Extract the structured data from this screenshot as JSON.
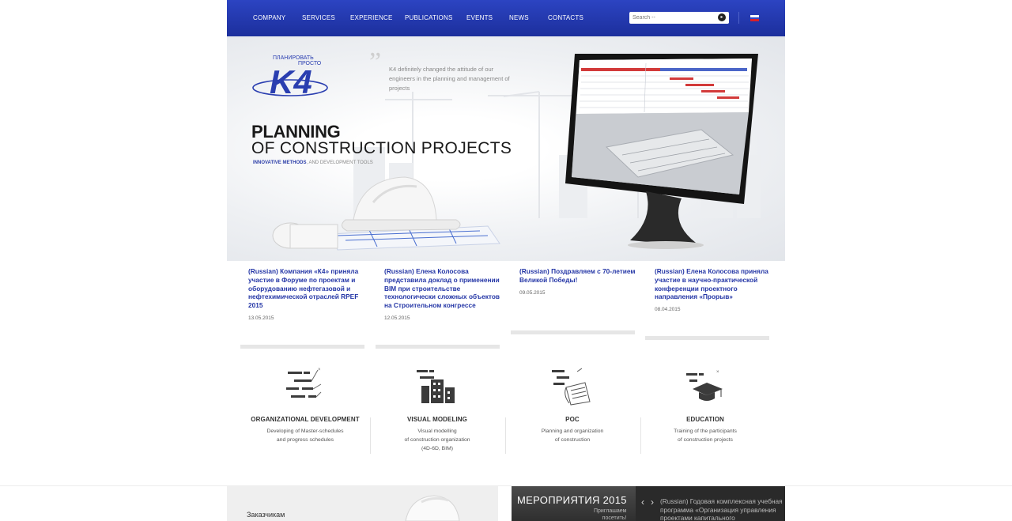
{
  "nav": {
    "items": [
      "COMPANY",
      "SERVICES",
      "EXPERIENCE",
      "PUBLICATIONS",
      "EVENTS",
      "NEWS",
      "CONTACTS"
    ],
    "search_placeholder": "Search --",
    "search_icon": "arrow-right-circle-icon",
    "language": "ru-flag-icon"
  },
  "hero": {
    "logo_text": "ПЛАНИРОВАТЬ ПРОСТО",
    "logo_mark": "K4",
    "quote": "K4 definitely changed the attitude of our engineers in the planning and management of projects",
    "title_line1": "PLANNING",
    "title_line2": "OF CONSTRUCTION PROJECTS",
    "subtitle_highlight": "INNOVATIVE METHODS",
    "subtitle_rest": ", AND DEVELOPMENT TOOLS"
  },
  "news": [
    {
      "title": "(Russian) Компания «К4» приняла участие в Форуме по проектам и оборудованию нефтегазовой и нефтехимической отраслей RPEF 2015",
      "date": "13.05.2015"
    },
    {
      "title": "(Russian) Елена Колосова представила доклад о применении BIM при строительстве технологически сложных объектов на Строительном конгрессе",
      "date": "12.05.2015"
    },
    {
      "title": "(Russian) Поздравляем с 70-летием Великой Победы!",
      "date": "09.05.2015"
    },
    {
      "title": "(Russian) Елена Колосова приняла участие в научно-практической конференции проектного направления «Прорыв»",
      "date": "08.04.2015"
    }
  ],
  "services": [
    {
      "title": "ORGANIZATIONAL DEVELOPMENT",
      "desc": [
        "Developing of Master-schedules",
        "and progress schedules"
      ],
      "icon": "org-chart-icon"
    },
    {
      "title": "VISUAL MODELING",
      "desc": [
        "Visual modelling",
        "of construction organization",
        "(4D-6D, BIM)"
      ],
      "icon": "building-icon"
    },
    {
      "title": "POC",
      "desc": [
        "Planning and organization",
        "of construction"
      ],
      "icon": "document-icon"
    },
    {
      "title": "EDUCATION",
      "desc": [
        "Training of the participants",
        "of construction projects"
      ],
      "icon": "graduation-cap-icon"
    }
  ],
  "bottom": {
    "clients_label": "Заказчикам",
    "events_title": "МЕРОПРИЯТИЯ 2015",
    "events_sub_line1": "Приглашаем",
    "events_sub_line2": "посетить!",
    "events_text": "(Russian) Годовая комплексная учебная программа «Организация управления проектами капитального",
    "prev_icon": "chevron-left-icon",
    "next_icon": "chevron-right-icon"
  },
  "colors": {
    "nav_blue": "#2338b4",
    "link_blue": "#2436a6",
    "events_bg": "#2a2a2a"
  }
}
